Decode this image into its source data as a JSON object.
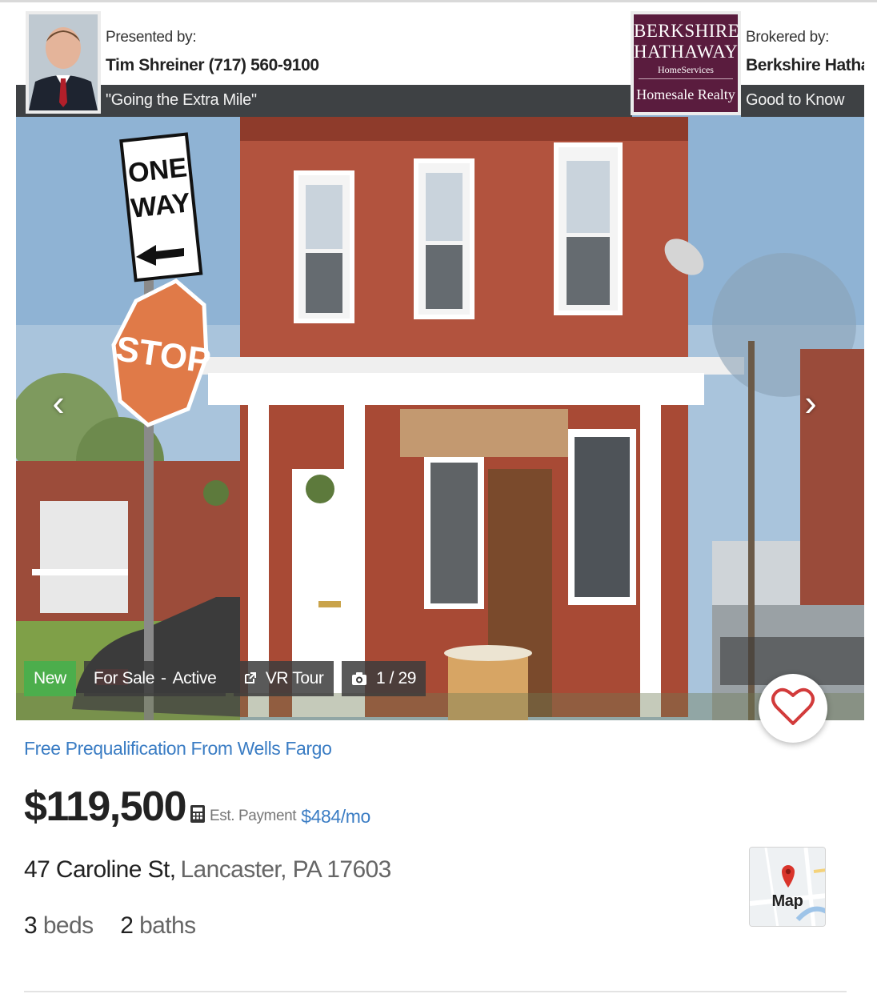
{
  "agent": {
    "presented_label": "Presented by:",
    "name": "Tim Shreiner (717) 560-9100",
    "slogan": "\"Going the Extra Mile\""
  },
  "broker": {
    "logo_line1": "BERKSHIRE",
    "logo_line2": "HATHAWAY",
    "logo_line3": "HomeServices",
    "logo_line4": "Homesale Realty",
    "brokered_label": "Brokered by:",
    "name": "Berkshire Hathaway",
    "tagline": "Good to Know"
  },
  "photo": {
    "sign_one": "ONE",
    "sign_way": "WAY",
    "sign_stop": "STOP",
    "prev_icon": "chevron-left-icon",
    "next_icon": "chevron-right-icon"
  },
  "badges": {
    "new": "New",
    "for_sale": "For Sale",
    "dash": "-",
    "active": "Active",
    "vr_tour": "VR Tour",
    "photo_count": "1 / 29"
  },
  "listing": {
    "prequal_link": "Free Prequalification From Wells Fargo",
    "price": "$119,500",
    "payment_label": "Est. Payment",
    "payment_amount": "$484/mo",
    "street": "47 Caroline St,",
    "city": "Lancaster, PA 17603",
    "beds_count": "3",
    "beds_label": "beds",
    "baths_count": "2",
    "baths_label": "baths",
    "map_label": "Map"
  },
  "colors": {
    "link_blue": "#3b7dc4",
    "new_badge_green": "#4cae4c",
    "broker_maroon": "#5a1c3e",
    "heart_red": "#d23b3b"
  }
}
